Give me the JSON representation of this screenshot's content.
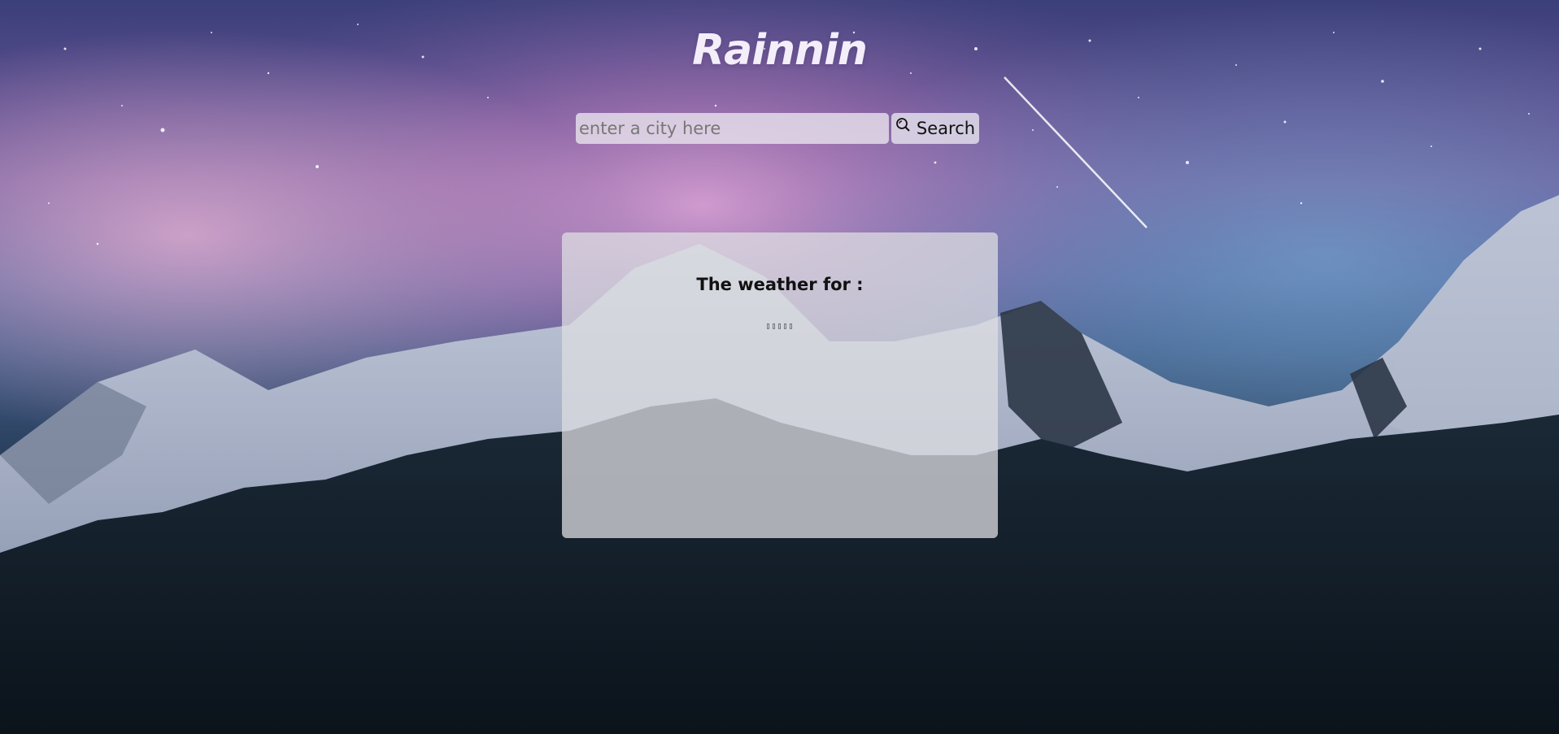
{
  "app": {
    "title": "Rainnin"
  },
  "search": {
    "placeholder": "enter a city here",
    "value": "",
    "button_label": "Search",
    "button_icon": "search-icon"
  },
  "weather_card": {
    "heading": "The weather for :",
    "value": "▯▯▯▯▯"
  },
  "colors": {
    "sky_top": "#3b3f7a",
    "nebula_pink": "#c98bc0",
    "mountain_snow": "#dfe2ea",
    "forest": "#121c26"
  }
}
